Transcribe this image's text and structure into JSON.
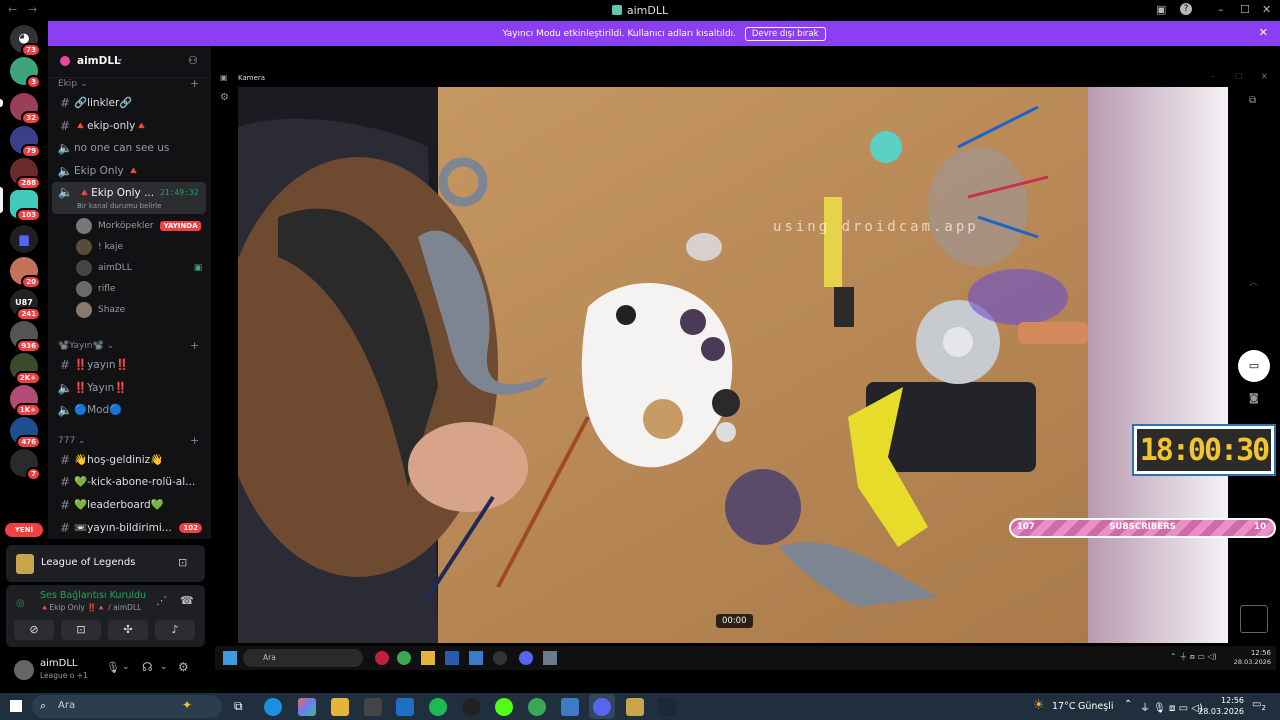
{
  "window": {
    "title": "aimDLL"
  },
  "banner": {
    "text": "Yayıncı Modu etkinleştirildi. Kullanıcı adları kısaltıldı.",
    "button": "Devre dışı bırak"
  },
  "servers": {
    "badges": [
      "73",
      "3",
      "32",
      "79",
      "288",
      "103",
      "20",
      "241",
      "936",
      "2K+",
      "1K+",
      "476",
      "7"
    ],
    "new_label": "YENİ"
  },
  "sidebar": {
    "server_name": "aimDLL",
    "category_1": "Ekip",
    "channels_1": [
      {
        "icon": "#",
        "name": "🔗linkler🔗"
      },
      {
        "icon": "#",
        "name": "🔺ekip-only🔺"
      },
      {
        "icon": "🔈",
        "name": "no one can see us"
      },
      {
        "icon": "🔈",
        "name": "Ekip Only 🔺"
      },
      {
        "icon": "🔈",
        "name": "🔺Ekip Only ...",
        "time": "21:49:32",
        "status": "Bir kanal durumu belirle"
      }
    ],
    "members": [
      {
        "name": "Morköpekler",
        "badge": "YAYINDA"
      },
      {
        "name": "! kaje"
      },
      {
        "name": "aimDLL"
      },
      {
        "name": "rifle"
      },
      {
        "name": "Shaze"
      }
    ],
    "category_2": "📽️Yayın📽️",
    "channels_2": [
      {
        "icon": "#",
        "name": "‼️yayın‼️"
      },
      {
        "icon": "🔈",
        "name": "‼️Yayın‼️"
      },
      {
        "icon": "🔈",
        "name": "🔵Mod🔵"
      }
    ],
    "category_3": "777",
    "channels_3": [
      {
        "icon": "#",
        "name": "👋hoş-geldiniz👋"
      },
      {
        "icon": "#",
        "name": "💚-kick-abone-rolü-al..."
      },
      {
        "icon": "#",
        "name": "💚leaderboard💚"
      },
      {
        "icon": "#",
        "name": "📼yayın-bildirimi...",
        "badge": "102"
      }
    ]
  },
  "bottom": {
    "game": "League of Legends",
    "voice_status": "Ses Bağlantısı Kuruldu",
    "voice_channel": "🔺Ekip Only ‼️🔺 / aimDLL",
    "user_name": "aimDLL",
    "user_status": "League o +1"
  },
  "stream": {
    "camera_label": "Kamera",
    "watermark": "using droidcam.app",
    "timer": "18:00:30",
    "subs_left": "107",
    "subs_label": "SUBSCRIBERS",
    "subs_right": "10",
    "video_time": "00:00",
    "inner_taskbar": {
      "search": "Ara",
      "time": "12:56",
      "date": "28.03.2026"
    }
  },
  "taskbar": {
    "search": "Ara",
    "weather": "17°C",
    "weather_text": "Güneşli",
    "time": "12:56",
    "date": "28.03.2026",
    "notif": "2"
  }
}
